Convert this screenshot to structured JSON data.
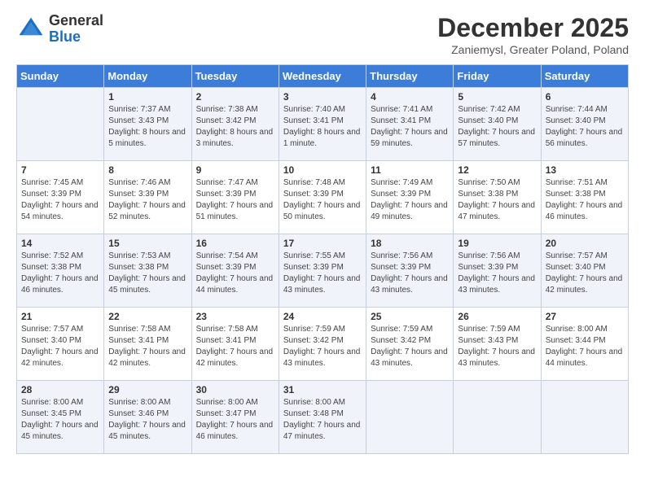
{
  "logo": {
    "general": "General",
    "blue": "Blue"
  },
  "title": "December 2025",
  "location": "Zaniemysl, Greater Poland, Poland",
  "days_of_week": [
    "Sunday",
    "Monday",
    "Tuesday",
    "Wednesday",
    "Thursday",
    "Friday",
    "Saturday"
  ],
  "weeks": [
    [
      {
        "day": "",
        "sunrise": "",
        "sunset": "",
        "daylight": ""
      },
      {
        "day": "1",
        "sunrise": "Sunrise: 7:37 AM",
        "sunset": "Sunset: 3:43 PM",
        "daylight": "Daylight: 8 hours and 5 minutes."
      },
      {
        "day": "2",
        "sunrise": "Sunrise: 7:38 AM",
        "sunset": "Sunset: 3:42 PM",
        "daylight": "Daylight: 8 hours and 3 minutes."
      },
      {
        "day": "3",
        "sunrise": "Sunrise: 7:40 AM",
        "sunset": "Sunset: 3:41 PM",
        "daylight": "Daylight: 8 hours and 1 minute."
      },
      {
        "day": "4",
        "sunrise": "Sunrise: 7:41 AM",
        "sunset": "Sunset: 3:41 PM",
        "daylight": "Daylight: 7 hours and 59 minutes."
      },
      {
        "day": "5",
        "sunrise": "Sunrise: 7:42 AM",
        "sunset": "Sunset: 3:40 PM",
        "daylight": "Daylight: 7 hours and 57 minutes."
      },
      {
        "day": "6",
        "sunrise": "Sunrise: 7:44 AM",
        "sunset": "Sunset: 3:40 PM",
        "daylight": "Daylight: 7 hours and 56 minutes."
      }
    ],
    [
      {
        "day": "7",
        "sunrise": "Sunrise: 7:45 AM",
        "sunset": "Sunset: 3:39 PM",
        "daylight": "Daylight: 7 hours and 54 minutes."
      },
      {
        "day": "8",
        "sunrise": "Sunrise: 7:46 AM",
        "sunset": "Sunset: 3:39 PM",
        "daylight": "Daylight: 7 hours and 52 minutes."
      },
      {
        "day": "9",
        "sunrise": "Sunrise: 7:47 AM",
        "sunset": "Sunset: 3:39 PM",
        "daylight": "Daylight: 7 hours and 51 minutes."
      },
      {
        "day": "10",
        "sunrise": "Sunrise: 7:48 AM",
        "sunset": "Sunset: 3:39 PM",
        "daylight": "Daylight: 7 hours and 50 minutes."
      },
      {
        "day": "11",
        "sunrise": "Sunrise: 7:49 AM",
        "sunset": "Sunset: 3:39 PM",
        "daylight": "Daylight: 7 hours and 49 minutes."
      },
      {
        "day": "12",
        "sunrise": "Sunrise: 7:50 AM",
        "sunset": "Sunset: 3:38 PM",
        "daylight": "Daylight: 7 hours and 47 minutes."
      },
      {
        "day": "13",
        "sunrise": "Sunrise: 7:51 AM",
        "sunset": "Sunset: 3:38 PM",
        "daylight": "Daylight: 7 hours and 46 minutes."
      }
    ],
    [
      {
        "day": "14",
        "sunrise": "Sunrise: 7:52 AM",
        "sunset": "Sunset: 3:38 PM",
        "daylight": "Daylight: 7 hours and 46 minutes."
      },
      {
        "day": "15",
        "sunrise": "Sunrise: 7:53 AM",
        "sunset": "Sunset: 3:38 PM",
        "daylight": "Daylight: 7 hours and 45 minutes."
      },
      {
        "day": "16",
        "sunrise": "Sunrise: 7:54 AM",
        "sunset": "Sunset: 3:39 PM",
        "daylight": "Daylight: 7 hours and 44 minutes."
      },
      {
        "day": "17",
        "sunrise": "Sunrise: 7:55 AM",
        "sunset": "Sunset: 3:39 PM",
        "daylight": "Daylight: 7 hours and 43 minutes."
      },
      {
        "day": "18",
        "sunrise": "Sunrise: 7:56 AM",
        "sunset": "Sunset: 3:39 PM",
        "daylight": "Daylight: 7 hours and 43 minutes."
      },
      {
        "day": "19",
        "sunrise": "Sunrise: 7:56 AM",
        "sunset": "Sunset: 3:39 PM",
        "daylight": "Daylight: 7 hours and 43 minutes."
      },
      {
        "day": "20",
        "sunrise": "Sunrise: 7:57 AM",
        "sunset": "Sunset: 3:40 PM",
        "daylight": "Daylight: 7 hours and 42 minutes."
      }
    ],
    [
      {
        "day": "21",
        "sunrise": "Sunrise: 7:57 AM",
        "sunset": "Sunset: 3:40 PM",
        "daylight": "Daylight: 7 hours and 42 minutes."
      },
      {
        "day": "22",
        "sunrise": "Sunrise: 7:58 AM",
        "sunset": "Sunset: 3:41 PM",
        "daylight": "Daylight: 7 hours and 42 minutes."
      },
      {
        "day": "23",
        "sunrise": "Sunrise: 7:58 AM",
        "sunset": "Sunset: 3:41 PM",
        "daylight": "Daylight: 7 hours and 42 minutes."
      },
      {
        "day": "24",
        "sunrise": "Sunrise: 7:59 AM",
        "sunset": "Sunset: 3:42 PM",
        "daylight": "Daylight: 7 hours and 43 minutes."
      },
      {
        "day": "25",
        "sunrise": "Sunrise: 7:59 AM",
        "sunset": "Sunset: 3:42 PM",
        "daylight": "Daylight: 7 hours and 43 minutes."
      },
      {
        "day": "26",
        "sunrise": "Sunrise: 7:59 AM",
        "sunset": "Sunset: 3:43 PM",
        "daylight": "Daylight: 7 hours and 43 minutes."
      },
      {
        "day": "27",
        "sunrise": "Sunrise: 8:00 AM",
        "sunset": "Sunset: 3:44 PM",
        "daylight": "Daylight: 7 hours and 44 minutes."
      }
    ],
    [
      {
        "day": "28",
        "sunrise": "Sunrise: 8:00 AM",
        "sunset": "Sunset: 3:45 PM",
        "daylight": "Daylight: 7 hours and 45 minutes."
      },
      {
        "day": "29",
        "sunrise": "Sunrise: 8:00 AM",
        "sunset": "Sunset: 3:46 PM",
        "daylight": "Daylight: 7 hours and 45 minutes."
      },
      {
        "day": "30",
        "sunrise": "Sunrise: 8:00 AM",
        "sunset": "Sunset: 3:47 PM",
        "daylight": "Daylight: 7 hours and 46 minutes."
      },
      {
        "day": "31",
        "sunrise": "Sunrise: 8:00 AM",
        "sunset": "Sunset: 3:48 PM",
        "daylight": "Daylight: 7 hours and 47 minutes."
      },
      {
        "day": "",
        "sunrise": "",
        "sunset": "",
        "daylight": ""
      },
      {
        "day": "",
        "sunrise": "",
        "sunset": "",
        "daylight": ""
      },
      {
        "day": "",
        "sunrise": "",
        "sunset": "",
        "daylight": ""
      }
    ]
  ]
}
